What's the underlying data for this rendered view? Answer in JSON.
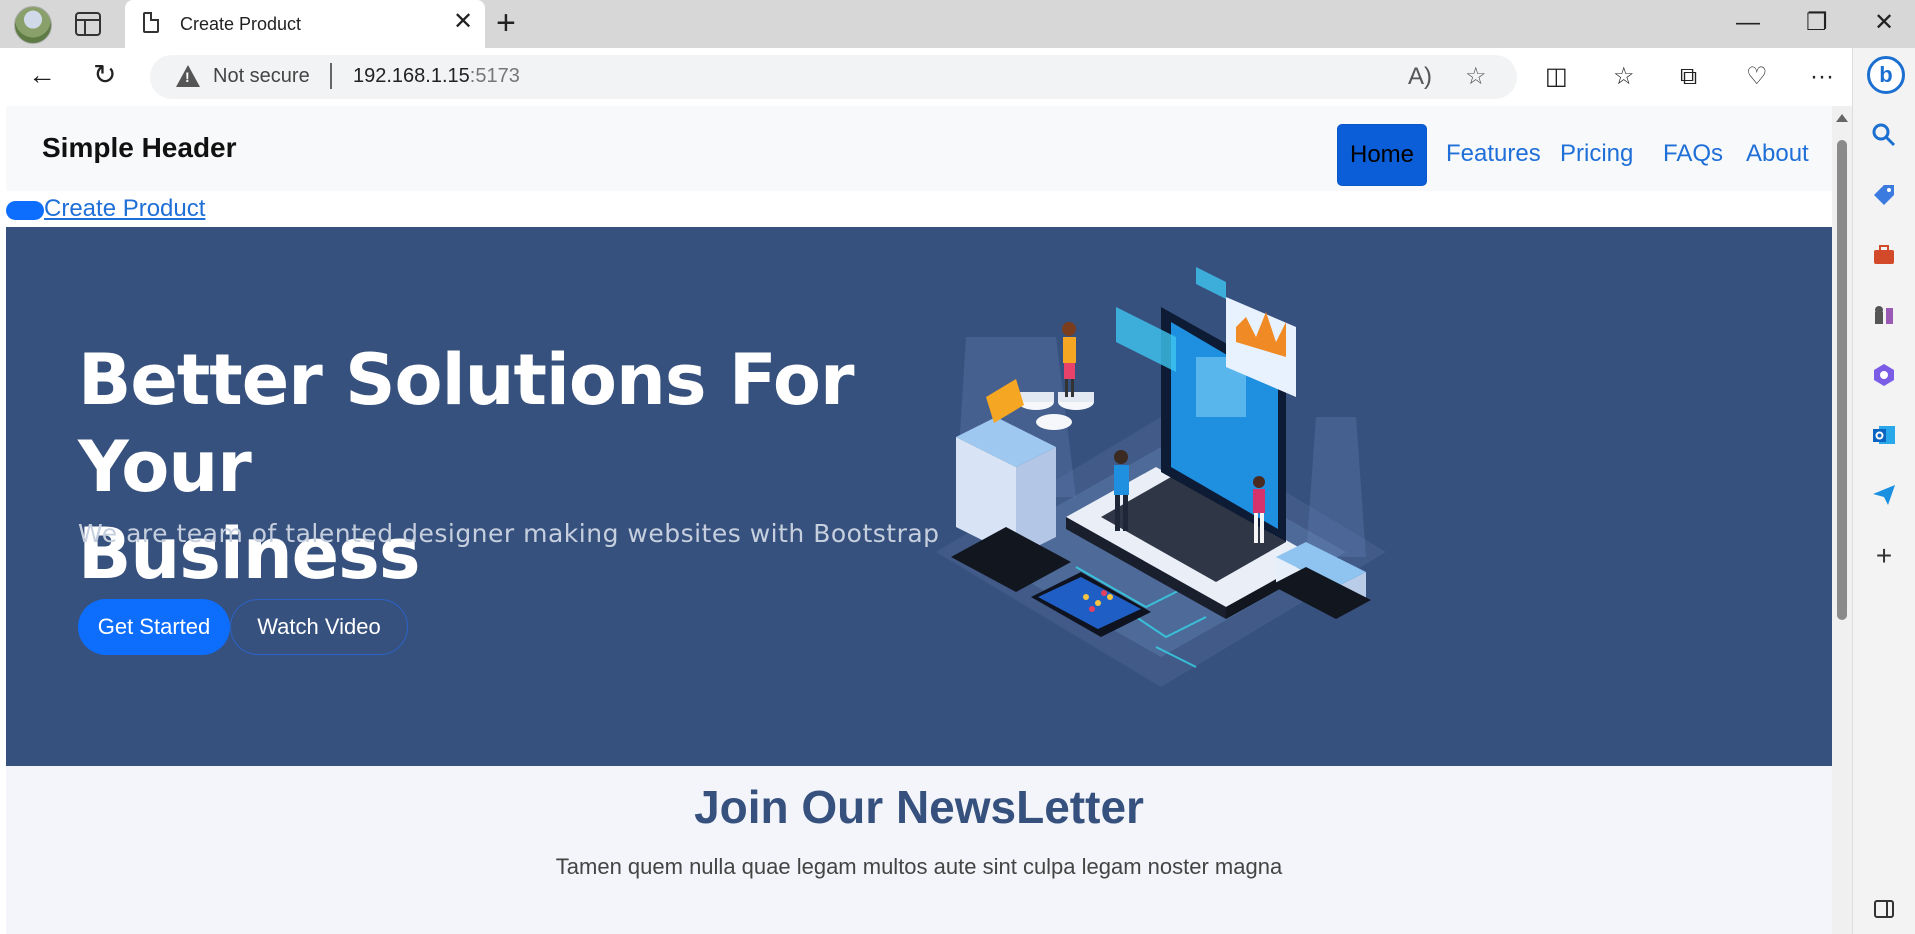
{
  "browser": {
    "tab_title": "Create Product",
    "tab_close": "✕",
    "new_tab": "+",
    "minimize": "—",
    "restore": "❐",
    "close": "✕",
    "not_secure": "Not secure",
    "url_host": "192.168.1.15",
    "url_port": ":5173",
    "back": "←",
    "refresh": "↻",
    "read_aloud": "A)",
    "favorite": "☆",
    "split": "◫",
    "favorites": "☆",
    "collections": "⧉",
    "performance": "♡",
    "more": "···",
    "bing": "b"
  },
  "sidebar": {
    "icons": [
      "search-icon",
      "tag-icon",
      "briefcase-icon",
      "games-icon",
      "microsoft365-icon",
      "outlook-icon",
      "send-icon",
      "add-icon",
      "sidebar-toggle-icon"
    ],
    "add": "+"
  },
  "header": {
    "brand": "Simple Header",
    "nav": [
      "Home",
      "Features",
      "Pricing",
      "FAQs",
      "About"
    ],
    "active": "Home"
  },
  "create_link": "Create Product",
  "hero": {
    "title_line1": "Better Solutions For Your",
    "title_line2": "Business",
    "subtitle": "We are team of talented designer making websites with Bootstrap",
    "primary_button": "Get Started",
    "secondary_button": "Watch Video"
  },
  "newsletter": {
    "title": "Join Our NewsLetter",
    "text": "Tamen quem nulla quae legam multos aute sint culpa legam noster magna"
  },
  "colors": {
    "hero_bg": "#37517e",
    "primary": "#0d6efd",
    "link": "#1f6fd8"
  }
}
